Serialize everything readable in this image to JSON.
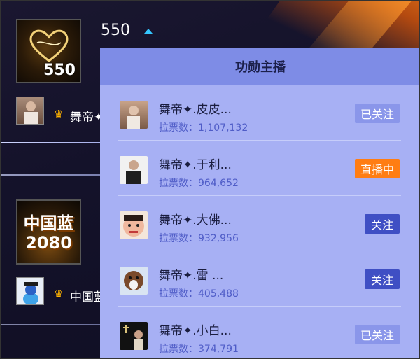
{
  "colors": {
    "panel_bg": "#a7b0f4",
    "panel_header": "#7e8ce6",
    "live": "#ff7d13",
    "follow": "#3f4fc4",
    "followed": "#8a96ea",
    "accent_caret": "#35c7ff"
  },
  "top_card": {
    "score": "550",
    "thumb_number": "550"
  },
  "mini_users": [
    {
      "crown_icon": "♛",
      "name": "舞帝✦"
    },
    {
      "crown_icon": "♛",
      "name": "中国蓝"
    }
  ],
  "second_card": {
    "line1": "中国蓝",
    "line2": "2080"
  },
  "panel": {
    "title": "功勋主播",
    "rows": [
      {
        "name": "舞帝✦.皮皮...",
        "votes": "拉票数：1,107,132",
        "action": "已关注",
        "state": "followed"
      },
      {
        "name": "舞帝✦.于利...",
        "votes": "拉票数：964,652",
        "action": "直播中",
        "state": "live"
      },
      {
        "name": "舞帝✦.大佛...",
        "votes": "拉票数：932,956",
        "action": "关注",
        "state": "follow"
      },
      {
        "name": "舞帝✦.雷 ...",
        "votes": "拉票数：405,488",
        "action": "关注",
        "state": "follow"
      },
      {
        "name": "舞帝✦.小白...",
        "votes": "拉票数：374,791",
        "action": "已关注",
        "state": "followed"
      }
    ]
  }
}
